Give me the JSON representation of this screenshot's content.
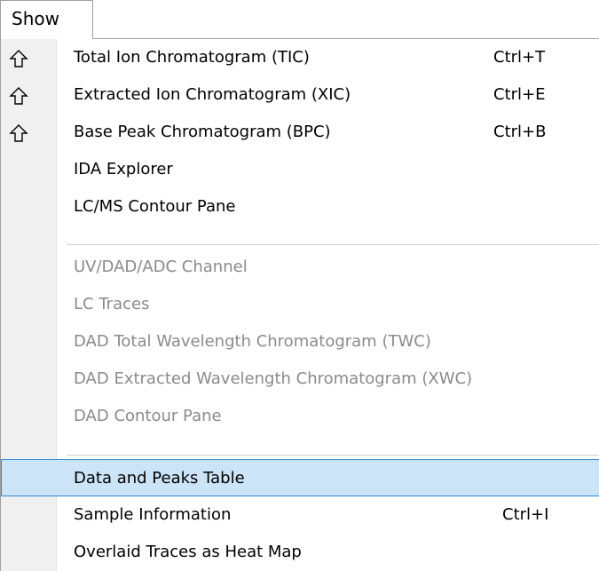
{
  "menu": {
    "title": "Show"
  },
  "items": [
    {
      "label": "Total Ion Chromatogram (TIC)",
      "shortcut": "Ctrl+T",
      "icon": "up-arrow-icon",
      "enabled": true
    },
    {
      "label": "Extracted Ion Chromatogram (XIC)",
      "shortcut": "Ctrl+E",
      "icon": "up-arrow-icon",
      "enabled": true
    },
    {
      "label": "Base Peak Chromatogram (BPC)",
      "shortcut": "Ctrl+B",
      "icon": "up-arrow-icon",
      "enabled": true
    },
    {
      "label": "IDA Explorer",
      "shortcut": "",
      "enabled": true
    },
    {
      "label": "LC/MS Contour Pane",
      "shortcut": "",
      "enabled": true
    },
    {
      "label": "UV/DAD/ADC Channel",
      "shortcut": "",
      "enabled": false
    },
    {
      "label": "LC Traces",
      "shortcut": "",
      "enabled": false
    },
    {
      "label": "DAD Total Wavelength Chromatogram (TWC)",
      "shortcut": "",
      "enabled": false
    },
    {
      "label": "DAD Extracted Wavelength Chromatogram (XWC)",
      "shortcut": "",
      "enabled": false
    },
    {
      "label": "DAD Contour Pane",
      "shortcut": "",
      "enabled": false
    },
    {
      "label": "Data and Peaks Table",
      "shortcut": "",
      "enabled": true,
      "highlighted": true
    },
    {
      "label": "Sample Information",
      "shortcut": "Ctrl+I",
      "enabled": true
    },
    {
      "label": "Overlaid Traces as Heat Map",
      "shortcut": "",
      "enabled": true
    }
  ],
  "colors": {
    "highlight_fill": "#cce4f7",
    "highlight_border": "#2b8ad9",
    "disabled_text": "#8a8a8a",
    "gutter": "#f0f0f0"
  }
}
